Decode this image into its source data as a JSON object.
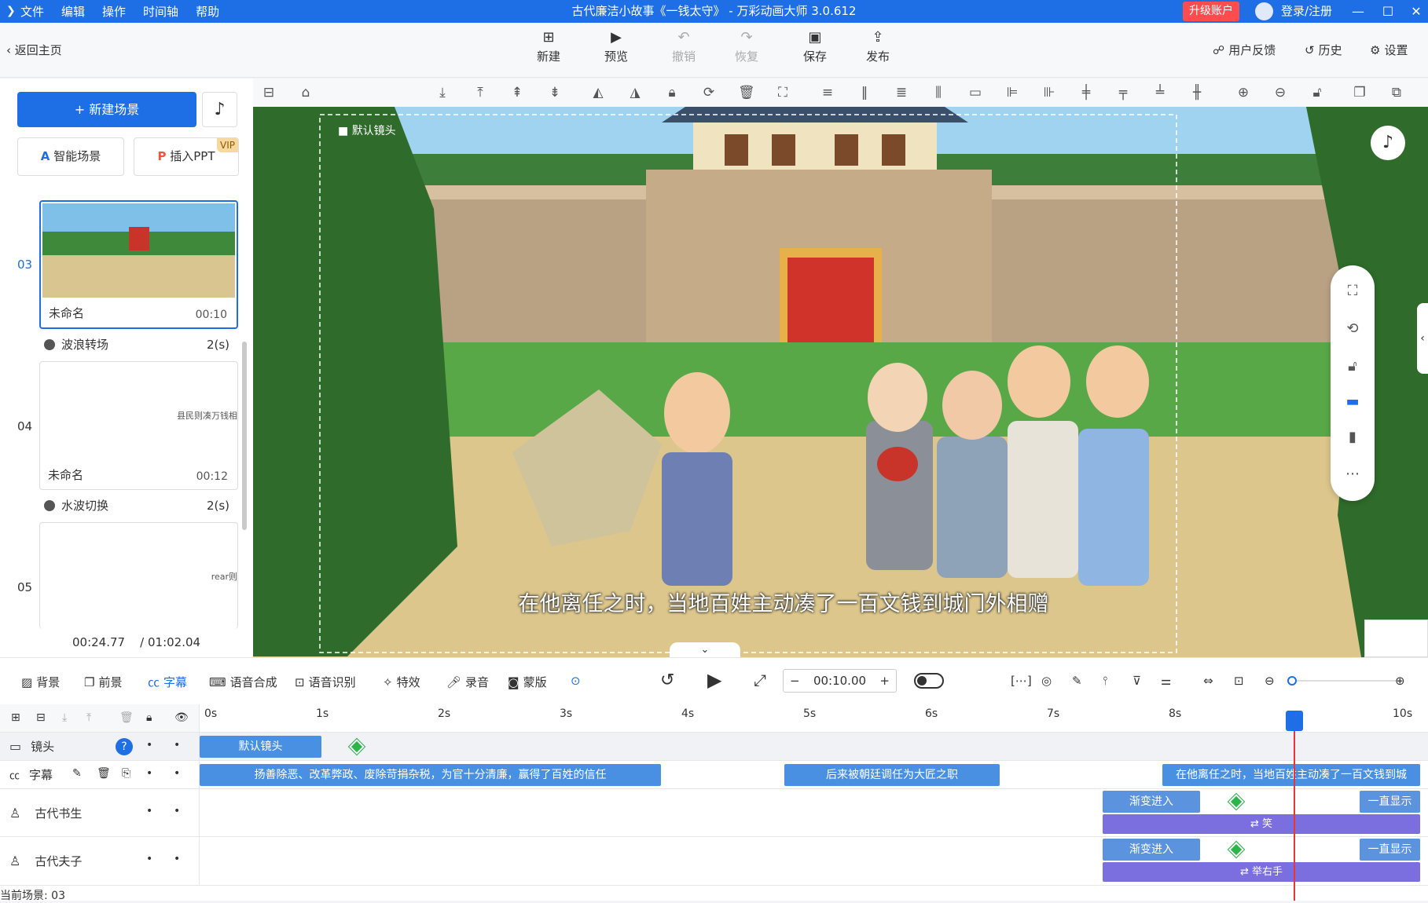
{
  "titlebar": {
    "menus": [
      "文件",
      "编辑",
      "操作",
      "时间轴",
      "帮助"
    ],
    "title": "古代廉洁小故事《一钱太守》 - 万彩动画大师 3.0.612",
    "upgrade": "升级账户",
    "login": "登录/注册"
  },
  "toolbar": {
    "back": "返回主页",
    "buttons": [
      "新建",
      "预览",
      "撤销",
      "恢复",
      "保存",
      "发布"
    ],
    "right": [
      "用户反馈",
      "历史",
      "设置"
    ]
  },
  "left": {
    "new_scene": "+ 新建场景",
    "smart_scene": "智能场景",
    "insert_ppt": "插入PPT",
    "vip": "VIP",
    "scenes": [
      {
        "num": "03",
        "name": "未命名",
        "time": "00:10"
      },
      {
        "num": "04",
        "name": "未命名",
        "time": "00:12",
        "preview_text": "县民则凑万钱相"
      },
      {
        "num": "05",
        "name": "",
        "time": "",
        "preview_text": "rear则"
      }
    ],
    "transitions": [
      {
        "name": "波浪转场",
        "dur": "2(s)"
      },
      {
        "name": "水波切换",
        "dur": "2(s)"
      }
    ],
    "time_current": "00:24.77",
    "time_total": "/ 01:02.04"
  },
  "stage": {
    "camera_label": "默认镜头",
    "subtitle": "在他离任之时，当地百姓主动凑了一百文钱到城门外相赠"
  },
  "editbar": {
    "items": [
      "背景",
      "前景",
      "字幕",
      "语音合成",
      "语音识别",
      "特效",
      "录音",
      "蒙版"
    ],
    "time": "00:10.00"
  },
  "timeline": {
    "ruler": [
      "0s",
      "1s",
      "2s",
      "3s",
      "4s",
      "5s",
      "6s",
      "7s",
      "8s",
      "10s"
    ],
    "tracks": [
      {
        "name": "镜头"
      },
      {
        "name": "字幕"
      },
      {
        "name": "古代书生"
      },
      {
        "name": "古代夫子"
      }
    ],
    "camera_clip": "默认镜头",
    "subtitle_clips": [
      "扬善除恶、改革弊政、废除苛捐杂税，为官十分清廉，赢得了百姓的信任",
      "后来被朝廷调任为大匠之职",
      "在他离任之时，当地百姓主动凑了一百文钱到城"
    ],
    "enter_fx": "渐变进入",
    "always_show": "一直显示",
    "action1": "⇄ 笑",
    "action2": "⇄ 举右手",
    "status": "当前场景: 03"
  },
  "colors": {
    "accent": "#1e6ee6",
    "upgrade": "#ff4d4f",
    "playhead": "#e33333",
    "action": "#7b6fe0"
  }
}
